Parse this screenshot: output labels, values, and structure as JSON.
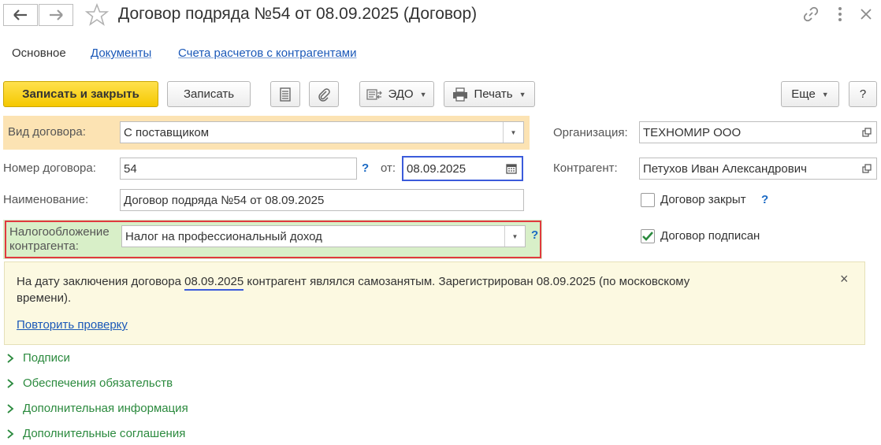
{
  "header": {
    "title": "Договор подряда №54 от 08.09.2025 (Договор)",
    "back_icon": "arrow-left-icon",
    "forward_icon": "arrow-right-icon",
    "favorite_icon": "star-icon",
    "link_icon": "link-icon",
    "more_icon": "vertical-dots-icon",
    "close_icon": "close-icon"
  },
  "tabs": [
    {
      "label": "Основное"
    },
    {
      "label": "Документы"
    },
    {
      "label": "Счета расчетов с контрагентами"
    }
  ],
  "toolbar": {
    "save_close_label": "Записать и закрыть",
    "save_label": "Записать",
    "edo_label": "ЭДО",
    "print_label": "Печать",
    "more_label": "Еще",
    "help_label": "?"
  },
  "form": {
    "contract_type": {
      "label": "Вид договора:",
      "value": "С поставщиком"
    },
    "number": {
      "label": "Номер договора:",
      "value": "54",
      "help": "?",
      "date_label": "от:",
      "date_value": "08.09.2025"
    },
    "name": {
      "label": "Наименование:",
      "value": "Договор подряда №54 от 08.09.2025"
    },
    "taxation": {
      "label_line1": "Налогообложение",
      "label_line2": "контрагента:",
      "value": "Налог на профессиональный доход",
      "help": "?"
    },
    "organization": {
      "label": "Организация:",
      "value": "ТЕХНОМИР ООО"
    },
    "counterparty": {
      "label": "Контрагент:",
      "value": "Петухов Иван Александрович"
    },
    "closed": {
      "label": "Договор закрыт",
      "checked": false,
      "help": "?"
    },
    "signed": {
      "label": "Договор подписан",
      "checked": true
    }
  },
  "notice": {
    "text_before": "На дату заключения договора ",
    "date": "08.09.2025",
    "text_after": " контрагент являлся самозанятым. Зарегистрирован 08.09.2025 (по московскому",
    "text_line2": "времени).",
    "action_link": "Повторить проверку",
    "close": "×"
  },
  "groups": [
    {
      "label": "Подписи"
    },
    {
      "label": "Обеспечения обязательств"
    },
    {
      "label": "Дополнительная информация"
    },
    {
      "label": "Дополнительные соглашения"
    }
  ],
  "colors": {
    "accent_yellow": "#f5c800",
    "highlight_orange": "#fce3b3",
    "highlight_green": "#d8efc8",
    "red_frame": "#e0393e",
    "blue_frame": "#3b5bdb",
    "link_blue": "#1a58b8",
    "group_green": "#2b8a3e"
  }
}
